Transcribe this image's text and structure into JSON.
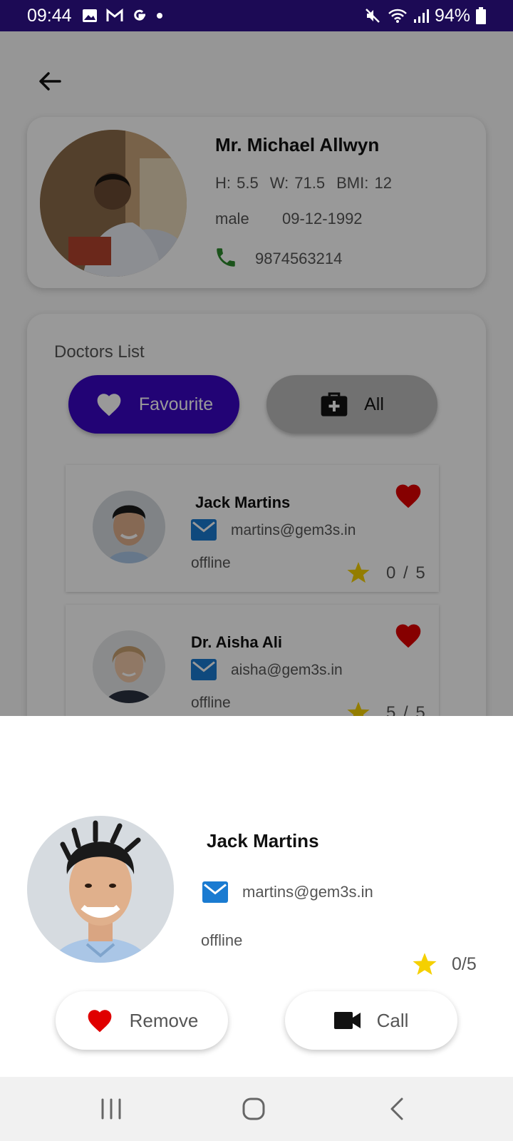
{
  "status_bar": {
    "time": "09:44",
    "notification_icons": [
      "gallery-icon",
      "gmail-icon",
      "google-icon",
      "dot-icon"
    ],
    "battery": "94%",
    "bg_color": "#1c0a55"
  },
  "profile": {
    "name": "Mr. Michael Allwyn",
    "height": "H: 5.5",
    "weight": "W: 71.5",
    "bmi": "BMI: 12",
    "gender": "male",
    "dob": "09-12-1992",
    "phone": "9874563214",
    "phone_icon_color": "#2e8b2e"
  },
  "doctors": {
    "title": "Doctors List",
    "tabs": [
      {
        "label": "Favourite",
        "icon": "heart-icon",
        "active": true
      },
      {
        "label": "All",
        "icon": "medical-bag-icon",
        "active": false
      }
    ],
    "items": [
      {
        "name": "Jack Martins",
        "email": "martins@gem3s.in",
        "status": "offline",
        "rating": "0 / 5"
      },
      {
        "name": "Dr. Aisha Ali",
        "email": "aisha@gem3s.in",
        "status": "offline",
        "rating": "5 / 5"
      }
    ],
    "accent": "#3a06c4"
  },
  "sheet": {
    "name": "Jack Martins",
    "email": "martins@gem3s.in",
    "status": "offline",
    "rating": "0/5",
    "remove_label": "Remove",
    "call_label": "Call",
    "heart_color": "#e00000",
    "star_color": "#f5d000",
    "mail_color": "#1a7bd1"
  }
}
